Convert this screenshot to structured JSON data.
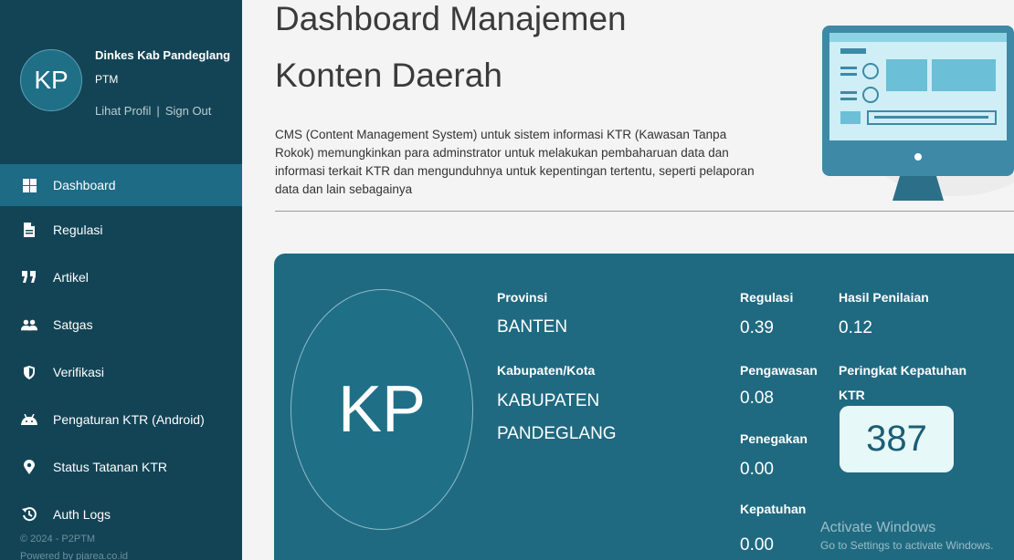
{
  "profile": {
    "initials": "KP",
    "name": "Dinkes Kab Pandeglang",
    "role": "PTM",
    "view_profile": "Lihat Profil",
    "separator": "|",
    "sign_out": "Sign Out"
  },
  "nav": [
    {
      "label": "Dashboard",
      "icon": "dashboard-grid-icon",
      "active": true
    },
    {
      "label": "Regulasi",
      "icon": "document-icon"
    },
    {
      "label": "Artikel",
      "icon": "quote-icon"
    },
    {
      "label": "Satgas",
      "icon": "users-icon"
    },
    {
      "label": "Verifikasi",
      "icon": "shield-icon"
    },
    {
      "label": "Pengaturan KTR (Android)",
      "icon": "android-icon"
    },
    {
      "label": "Status Tatanan KTR",
      "icon": "map-marker-icon"
    },
    {
      "label": "Auth Logs",
      "icon": "history-icon"
    }
  ],
  "footer": {
    "copyright": "© 2024 - P2PTM",
    "powered": "Powered by pjarea.co.id"
  },
  "main": {
    "title_line1": "Dashboard Manajemen",
    "title_line2": "Konten Daerah",
    "description": "CMS (Content Management System) untuk sistem informasi KTR (Kawasan Tanpa Rokok) memungkinkan para adminstrator untuk melakukan pembaharuan data dan informasi terkait KTR dan mengunduhnya untuk kepentingan tertentu, seperti pelaporan data dan lain sebagainya"
  },
  "card": {
    "initials": "KP",
    "provinsi_label": "Provinsi",
    "provinsi_value": "BANTEN",
    "kabupaten_label": "Kabupaten/Kota",
    "kabupaten_value_line1": "KABUPATEN",
    "kabupaten_value_line2": "PANDEGLANG",
    "regulasi_label": "Regulasi",
    "regulasi_value": "0.39",
    "pengawasan_label": "Pengawasan",
    "pengawasan_value": "0.08",
    "penegakan_label": "Penegakan",
    "penegakan_value": "0.00",
    "kepatuhan_label": "Kepatuhan",
    "kepatuhan_value": "0.00",
    "hasil_label": "Hasil Penilaian",
    "hasil_value": "0.12",
    "peringkat_label_line1": "Peringkat Kepatuhan",
    "peringkat_label_line2": "KTR",
    "peringkat_value": "387"
  },
  "watermark": {
    "title": "Activate Windows",
    "subtitle": "Go to Settings to activate Windows."
  },
  "colors": {
    "sidebar": "#134456",
    "active_nav": "#1d6b85",
    "card": "#1f6a81",
    "rank_box": "#e7f8f8"
  }
}
